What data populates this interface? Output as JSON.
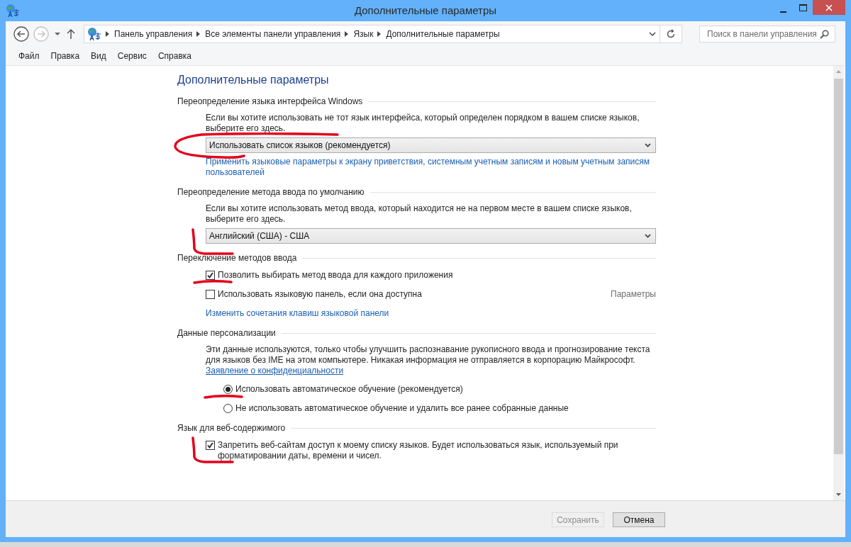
{
  "window": {
    "title": "Дополнительные параметры"
  },
  "address_bar": {
    "breadcrumbs": [
      "Панель управления",
      "Все элементы панели управления",
      "Язык",
      "Дополнительные параметры"
    ]
  },
  "search": {
    "placeholder": "Поиск в панели управления"
  },
  "menu": [
    "Файл",
    "Правка",
    "Вид",
    "Сервис",
    "Справка"
  ],
  "heading": "Дополнительные параметры",
  "sections": [
    {
      "title": "Переопределение языка интерфейса Windows",
      "items": [
        {
          "kind": "text",
          "text": "Если вы хотите использовать не тот язык интерфейса, который определен порядком в вашем списке языков, выберите его здесь."
        },
        {
          "kind": "dropdown",
          "value": "Использовать список языков (рекомендуется)",
          "annotation": {
            "kind": "oval"
          }
        },
        {
          "kind": "link",
          "text": "Применить языковые параметры к экрану приветствия, системным учетным записям и новым учетным записям пользователей"
        }
      ]
    },
    {
      "title": "Переопределение метода ввода по умолчанию",
      "items": [
        {
          "kind": "text",
          "text": "Если вы хотите использовать метод ввода, который находится не на первом месте в вашем списке языков, выберите его здесь."
        },
        {
          "kind": "dropdown",
          "value": "Английский (США) - США",
          "annotation": {
            "kind": "corner"
          }
        }
      ]
    },
    {
      "title": "Переключение методов ввода",
      "items": [
        {
          "kind": "checkbox",
          "label": "Позволить выбирать метод ввода для каждого приложения",
          "checked": true,
          "annotation": {
            "kind": "underline"
          }
        },
        {
          "kind": "checkbox",
          "label": "Использовать языковую панель, если она доступна",
          "checked": false,
          "side_link": {
            "text": "Параметры",
            "disabled": true
          }
        },
        {
          "kind": "link",
          "text": "Изменить сочетания клавиш языковой панели"
        }
      ]
    },
    {
      "title": "Данные персонализации",
      "items": [
        {
          "kind": "text",
          "text": "Эти данные используются, только чтобы улучшить распознавание рукописного ввода и прогнозирование текста для языков без IME на этом компьютере. Никакая информация не отправляется в корпорацию Майкрософт."
        },
        {
          "kind": "link",
          "text": "Заявление о конфиденциальности",
          "underlined": true
        },
        {
          "kind": "radio",
          "label": "Использовать автоматическое обучение (рекомендуется)",
          "selected": true,
          "annotation": {
            "kind": "underline"
          }
        },
        {
          "kind": "radio",
          "label": "Не использовать автоматическое обучение и удалить все ранее собранные данные",
          "selected": false
        }
      ]
    },
    {
      "title": "Язык для веб-содержимого",
      "items": [
        {
          "kind": "checkbox",
          "label": "Запретить веб-сайтам доступ к моему списку языков. Будет использоваться язык, используемый при форматировании даты, времени и чисел.",
          "checked": true,
          "annotation": {
            "kind": "corner"
          }
        }
      ]
    }
  ],
  "buttons": [
    {
      "label": "Сохранить",
      "disabled": true
    },
    {
      "label": "Отмена",
      "disabled": false
    }
  ]
}
